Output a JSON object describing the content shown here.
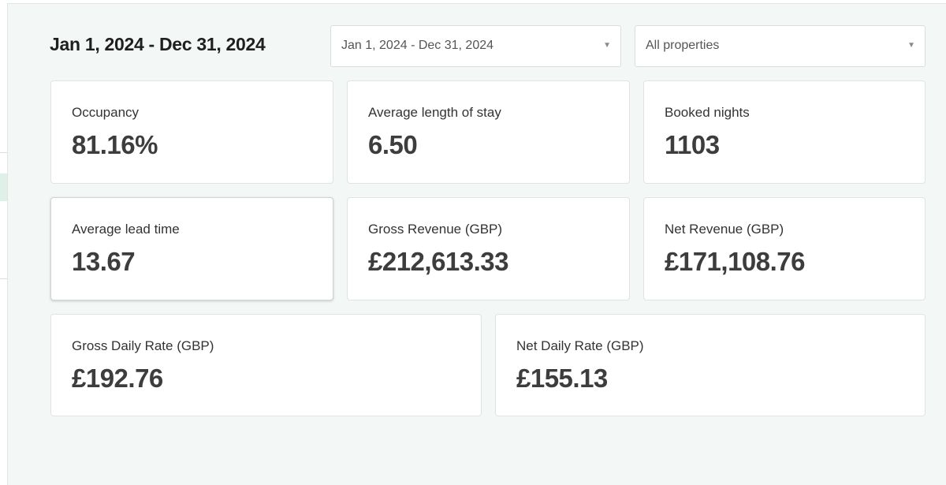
{
  "header": {
    "date_range_title": "Jan 1, 2024 - Dec 31, 2024"
  },
  "filters": {
    "date_range": {
      "value": "Jan 1, 2024 - Dec 31, 2024",
      "icon": "caret-down-icon"
    },
    "properties": {
      "value": "All properties",
      "icon": "caret-down-icon"
    }
  },
  "metrics": [
    {
      "label": "Occupancy",
      "value": "81.16%"
    },
    {
      "label": "Average length of stay",
      "value": "6.50"
    },
    {
      "label": "Booked nights",
      "value": "1103"
    },
    {
      "label": "Average lead time",
      "value": "13.67"
    },
    {
      "label": "Gross Revenue (GBP)",
      "value": "£212,613.33"
    },
    {
      "label": "Net Revenue (GBP)",
      "value": "£171,108.76"
    },
    {
      "label": "Gross Daily Rate (GBP)",
      "value": "£192.76"
    },
    {
      "label": "Net Daily Rate (GBP)",
      "value": "£155.13"
    }
  ],
  "colors": {
    "panel_background": "#f3f7f6",
    "card_background": "#ffffff",
    "sidebar_accent": "#dff0e8"
  }
}
